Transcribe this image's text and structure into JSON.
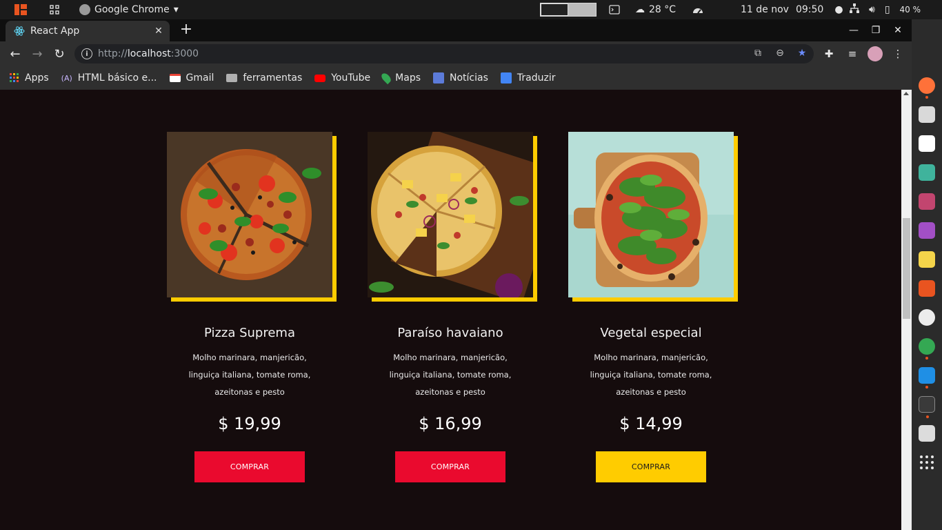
{
  "system_bar": {
    "app_name": "Google Chrome",
    "temperature": "28 °C",
    "date": "11 de nov",
    "time": "09:50",
    "battery": "40 %"
  },
  "browser": {
    "tab_title": "React App",
    "url_scheme": "http://",
    "url_host": "localhost",
    "url_port": ":3000",
    "bookmarks": [
      "Apps",
      "HTML básico e...",
      "Gmail",
      "ferramentas",
      "YouTube",
      "Maps",
      "Notícias",
      "Traduzir"
    ]
  },
  "products": [
    {
      "name": "Pizza Suprema",
      "description": "Molho marinara, manjericão, linguiça italiana, tomate roma, azeitonas e pesto",
      "price": "$ 19,99",
      "button": "COMPRAR",
      "button_color": "#ea0a2e"
    },
    {
      "name": "Paraíso havaiano",
      "description": "Molho marinara, manjericão, linguiça italiana, tomate roma, azeitonas e pesto",
      "price": "$ 16,99",
      "button": "COMPRAR",
      "button_color": "#ea0a2e"
    },
    {
      "name": "Vegetal especial",
      "description": "Molho marinara, manjericão, linguiça italiana, tomate roma, azeitonas e pesto",
      "price": "$ 14,99",
      "button": "COMPRAR",
      "button_color": "#ffcc00"
    }
  ],
  "colors": {
    "page_background": "#150c0d",
    "accent_yellow": "#ffcc00",
    "accent_red": "#ea0a2e"
  },
  "icons": [
    "ubuntu-logo-icon",
    "apps-grid-icon",
    "chrome-icon",
    "terminal-icon",
    "weather-icon",
    "speedometer-icon",
    "network-icon",
    "volume-icon",
    "battery-icon",
    "react-icon",
    "back-icon",
    "forward-icon",
    "reload-icon",
    "info-icon",
    "translate-icon",
    "zoom-icon",
    "star-icon",
    "extensions-icon",
    "media-icon",
    "menu-icon"
  ]
}
